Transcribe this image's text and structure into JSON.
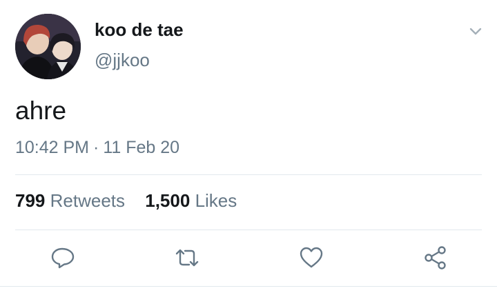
{
  "user": {
    "display_name": "koo de tae",
    "handle": "@jjkoo",
    "avatar_icon": "profile-photo"
  },
  "tweet": {
    "text": "ahre",
    "time": "10:42 PM",
    "separator": "·",
    "date": "11 Feb 20"
  },
  "stats": {
    "retweets_count": "799",
    "retweets_label": "Retweets",
    "likes_count": "1,500",
    "likes_label": "Likes"
  },
  "actions": [
    {
      "name": "reply",
      "icon": "reply-icon"
    },
    {
      "name": "retweet",
      "icon": "retweet-icon"
    },
    {
      "name": "like",
      "icon": "heart-icon"
    },
    {
      "name": "share",
      "icon": "share-icon"
    }
  ],
  "colors": {
    "text_primary": "#14171a",
    "text_secondary": "#657786",
    "icon": "#657786",
    "divider": "#e1e8ed"
  }
}
